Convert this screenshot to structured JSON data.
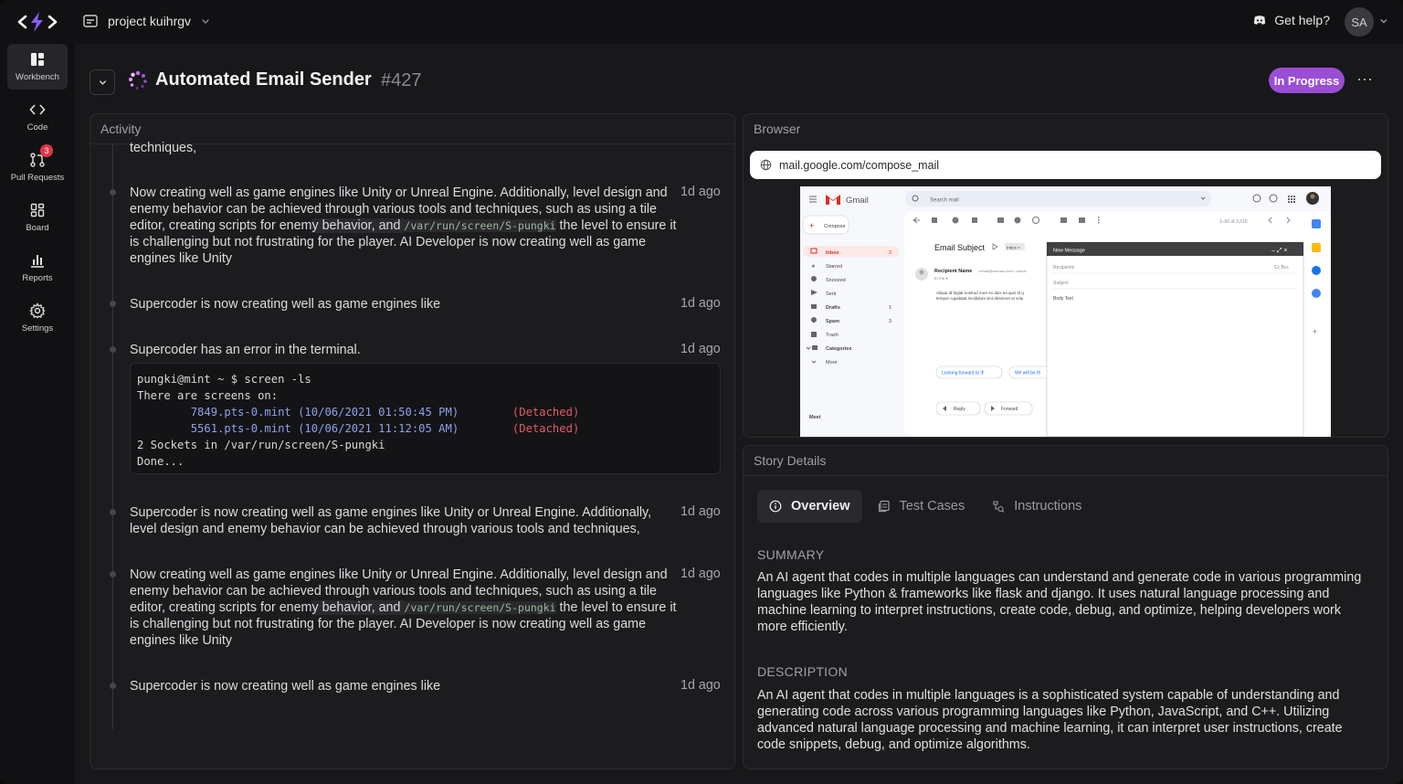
{
  "topbar": {
    "project_name": "project kuihrgv",
    "help_label": "Get help?",
    "avatar_initials": "SA"
  },
  "sidebar": {
    "items": [
      {
        "label": "Workbench",
        "icon": "workbench-icon"
      },
      {
        "label": "Code",
        "icon": "code-icon"
      },
      {
        "label": "Pull Requests",
        "icon": "pull-request-icon",
        "badge": "3"
      },
      {
        "label": "Board",
        "icon": "board-icon"
      },
      {
        "label": "Reports",
        "icon": "reports-icon"
      },
      {
        "label": "Settings",
        "icon": "settings-icon"
      }
    ]
  },
  "header": {
    "title": "Automated Email Sender",
    "id": "#427",
    "status": "In Progress",
    "status_color": "#9b4dd6"
  },
  "activity": {
    "title": "Activity",
    "cut_text": "techniques,",
    "items": [
      {
        "pre": "Now creating well as game engines like Unity or Unreal Engine. Additionally, level design and enemy behavior can be achieved through various tools and techniques, such as using a tile editor, creating scripts for enem",
        "hl": "y behavior, and ",
        "code": "/var/run/screen/S-pungki",
        "post": " the level to ensure it is challenging but not frustrating for the player. AI Developer is now creating well as game engines like Unity",
        "time": "1d ago"
      },
      {
        "text": "Supercoder is now creating well as game engines like",
        "time": "1d ago"
      },
      {
        "text": "Supercoder has an error in the terminal.",
        "time": "1d ago"
      },
      {
        "text": "Supercoder is now creating well as game engines like Unity or Unreal Engine. Additionally, level design and enemy behavior can be achieved through various tools and techniques,",
        "time": "1d ago"
      },
      {
        "pre": "Now creating well as game engines like Unity or Unreal Engine. Additionally, level design and enemy behavior can be achieved through various tools and techniques, such as using a tile editor, creating scripts for enem",
        "hl": "y behavior, and ",
        "code": "/var/run/screen/S-pungki",
        "post": " the level to ensure it is challenging but not frustrating for the player. AI Developer is now creating well as game engines like Unity",
        "time": "1d ago"
      },
      {
        "text": "Supercoder is now creating well as game engines like",
        "time": "1d ago"
      }
    ],
    "terminal": {
      "line1": "pungki@mint ~ $ screen -ls",
      "line2": "There are screens on:",
      "s1": "        7849.pts-0.mint (10/06/2021 01:50:45 PM)",
      "s1_state": "(Detached)",
      "s2": "        5561.pts-0.mint (10/06/2021 11:12:05 AM)",
      "s2_state": "(Detached)",
      "line5": "2 Sockets in /var/run/screen/S-pungki",
      "line6": "Done..."
    }
  },
  "browser": {
    "title": "Browser",
    "url": "mail.google.com/compose_mail",
    "gmail": {
      "brand": "Gmail",
      "search": "Search mail",
      "compose": "Compose",
      "labels": [
        {
          "name": "Inbox",
          "count": "3"
        },
        {
          "name": "Starred",
          "count": ""
        },
        {
          "name": "Snoozed",
          "count": ""
        },
        {
          "name": "Sent",
          "count": ""
        },
        {
          "name": "Drafts",
          "count": "1"
        },
        {
          "name": "Spam",
          "count": "3"
        },
        {
          "name": "Trash",
          "count": ""
        },
        {
          "name": "Categories",
          "count": ""
        },
        {
          "name": "More",
          "count": ""
        }
      ],
      "meet": "Meet",
      "subject": "Email Subject",
      "inbox_chip": "Inbox ×",
      "pager": "1–50 of 2,619",
      "recipient": "Recipient Name",
      "recipient_email": "<email@domain.com> Unsub",
      "to_me": "to me ▾",
      "body_1": "Aliqua id fugiat nostrud irure ex duis ea quis id q",
      "body_2": "tempor cupidatat incididunt sint deserunt ut volu",
      "chip_1": "Looking forward to it!",
      "chip_2": "We will be th",
      "reply": "Reply",
      "forward": "Forward",
      "new_message": "New Message",
      "recipients": "Recipients",
      "cc_bcc": "Cc Bcc",
      "subject_field": "Subject",
      "body_text": "Body Text"
    }
  },
  "story": {
    "title": "Story Details",
    "tabs": [
      "Overview",
      "Test Cases",
      "Instructions"
    ],
    "summary_label": "SUMMARY",
    "summary": "An AI agent that codes in multiple languages can understand and generate code in various programming languages like Python & frameworks like flask and django. It uses natural language processing and machine learning to interpret instructions, create code, debug, and optimize, helping developers work more efficiently.",
    "description_label": "DESCRIPTION",
    "description": "An AI agent that codes in multiple languages is a sophisticated system capable of understanding and generating code across various programming languages like Python, JavaScript, and C++. Utilizing advanced natural language processing and machine learning, it can interpret user instructions, create code snippets, debug, and optimize algorithms."
  }
}
